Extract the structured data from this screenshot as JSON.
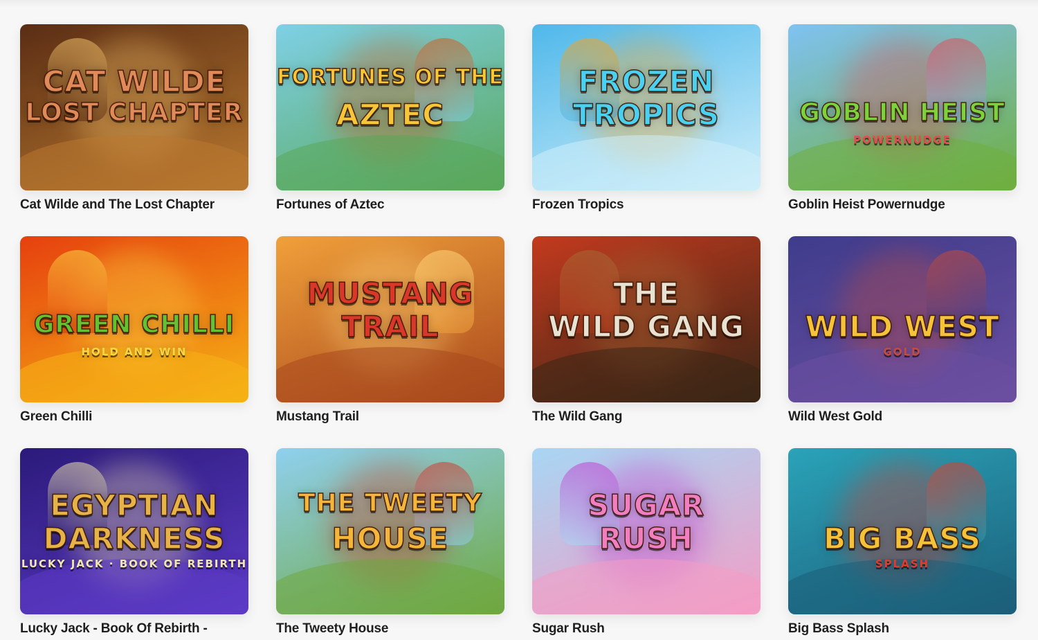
{
  "games": [
    {
      "title": "Cat Wilde and The Lost Chapter",
      "logo": [
        "Cat Wilde",
        "Lost Chapter"
      ],
      "sub": "",
      "colors": {
        "bg1": "#5a2d14",
        "bg2": "#b9792f",
        "logo": "#e08a5a",
        "accent": "#f3c26b"
      }
    },
    {
      "title": "Fortunes of Aztec",
      "logo": [
        "Fortunes of the",
        "Aztec"
      ],
      "sub": "",
      "colors": {
        "bg1": "#7ed0e6",
        "bg2": "#5aa85a",
        "logo": "#f6c63a",
        "accent": "#d25a1c"
      }
    },
    {
      "title": "Frozen Tropics",
      "logo": [
        "Frozen",
        "Tropics"
      ],
      "sub": "",
      "colors": {
        "bg1": "#4fb8ea",
        "bg2": "#cfeefa",
        "logo": "#4ad0f0",
        "accent": "#f7a21b"
      }
    },
    {
      "title": "Goblin Heist Powernudge",
      "logo": [
        "Goblin Heist"
      ],
      "sub": "Powernudge",
      "colors": {
        "bg1": "#7fc2f2",
        "bg2": "#6fae3e",
        "logo": "#7bd23c",
        "accent": "#e34a58"
      }
    },
    {
      "title": "Green Chilli",
      "logo": [
        "Green Chilli"
      ],
      "sub": "Hold and Win",
      "colors": {
        "bg1": "#e6400e",
        "bg2": "#f6b316",
        "logo": "#63c231",
        "accent": "#fbd645"
      }
    },
    {
      "title": "Mustang Trail",
      "logo": [
        "Mustang",
        "Trail"
      ],
      "sub": "",
      "colors": {
        "bg1": "#f0a03a",
        "bg2": "#a8481d",
        "logo": "#d9372a",
        "accent": "#ffd67a"
      }
    },
    {
      "title": "The Wild Gang",
      "logo": [
        "The",
        "Wild Gang"
      ],
      "sub": "",
      "colors": {
        "bg1": "#c33a1e",
        "bg2": "#3a2616",
        "logo": "#e8e2d2",
        "accent": "#a56a36"
      }
    },
    {
      "title": "Wild West Gold",
      "logo": [
        "Wild West"
      ],
      "sub": "Gold",
      "colors": {
        "bg1": "#3f3c8c",
        "bg2": "#6b4fa0",
        "logo": "#f5c33a",
        "accent": "#c64b3a"
      }
    },
    {
      "title": "Lucky Jack - Book Of Rebirth -",
      "logo": [
        "Egyptian",
        "Darkness"
      ],
      "sub": "Lucky Jack · Book of Rebirth",
      "colors": {
        "bg1": "#2b1a7a",
        "bg2": "#5d3bc6",
        "logo": "#e6b348",
        "accent": "#f1e6b0"
      }
    },
    {
      "title": "The Tweety House",
      "logo": [
        "The Tweety",
        "House"
      ],
      "sub": "",
      "colors": {
        "bg1": "#8fd0ef",
        "bg2": "#6fa83f",
        "logo": "#f4b63a",
        "accent": "#d2382b"
      }
    },
    {
      "title": "Sugar Rush",
      "logo": [
        "Sugar",
        "Rush"
      ],
      "sub": "",
      "colors": {
        "bg1": "#a8d6f4",
        "bg2": "#f49cc4",
        "logo": "#f07ec1",
        "accent": "#c040d0"
      }
    },
    {
      "title": "Big Bass Splash",
      "logo": [
        "Big Bass"
      ],
      "sub": "Splash",
      "colors": {
        "bg1": "#2aa3b8",
        "bg2": "#1c5f7a",
        "logo": "#f4c13a",
        "accent": "#e23b2b"
      }
    }
  ]
}
